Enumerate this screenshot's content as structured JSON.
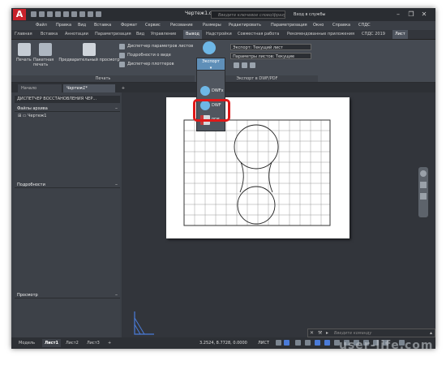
{
  "app": {
    "title": "Чертеж1.dwg",
    "search_placeholder": "Введите ключевое слово/фразу",
    "signin": "Вход в службы"
  },
  "menu": [
    "Файл",
    "Правка",
    "Вид",
    "Вставка",
    "Формат",
    "Сервис",
    "Рисование",
    "Размеры",
    "Редактировать",
    "Параметризация",
    "Окно",
    "Справка",
    "СПДС"
  ],
  "tabs": [
    "Главная",
    "Вставка",
    "Аннотации",
    "Параметризация",
    "Вид",
    "Управление",
    "Вывод",
    "Надстройки",
    "Совместная работа",
    "Рекомендованные приложения",
    "СПДС 2019",
    "Лист"
  ],
  "ribbon": {
    "print": "Печать",
    "batch_print": "Пакетная печать",
    "preview": "Предварительный просмотр",
    "page_setup": "Диспетчер параметров листов",
    "details": "Подробности о виде",
    "plotter_mgr": "Диспетчер плоттеров",
    "print_panel": "Печать",
    "export_btn": "Экспорт",
    "export_current": "Экспорт: Текущий лист",
    "sheet_params": "Параметры листов: Текущие",
    "export_panel": "Экспорт в DWF/PDF"
  },
  "export_menu": [
    "DWFx",
    "DWF",
    "PDF"
  ],
  "doc_tabs": [
    "Начало",
    "Чертеж1*"
  ],
  "panel": {
    "title": "ДИСПЕТЧЕР ВОССТАНОВЛЕНИЯ ЧЕР...",
    "archive": "Файлы архива",
    "file": "Чертеж1",
    "details": "Подробности",
    "preview": "Просмотр"
  },
  "command_placeholder": "Введите команду",
  "status": {
    "layouts": [
      "Модель",
      "Лист1",
      "Лист2",
      "Лист3"
    ],
    "coords": "3.2524, 8.7728, 0.0000",
    "space": "ЛИСТ"
  },
  "watermark": "user-life.com"
}
